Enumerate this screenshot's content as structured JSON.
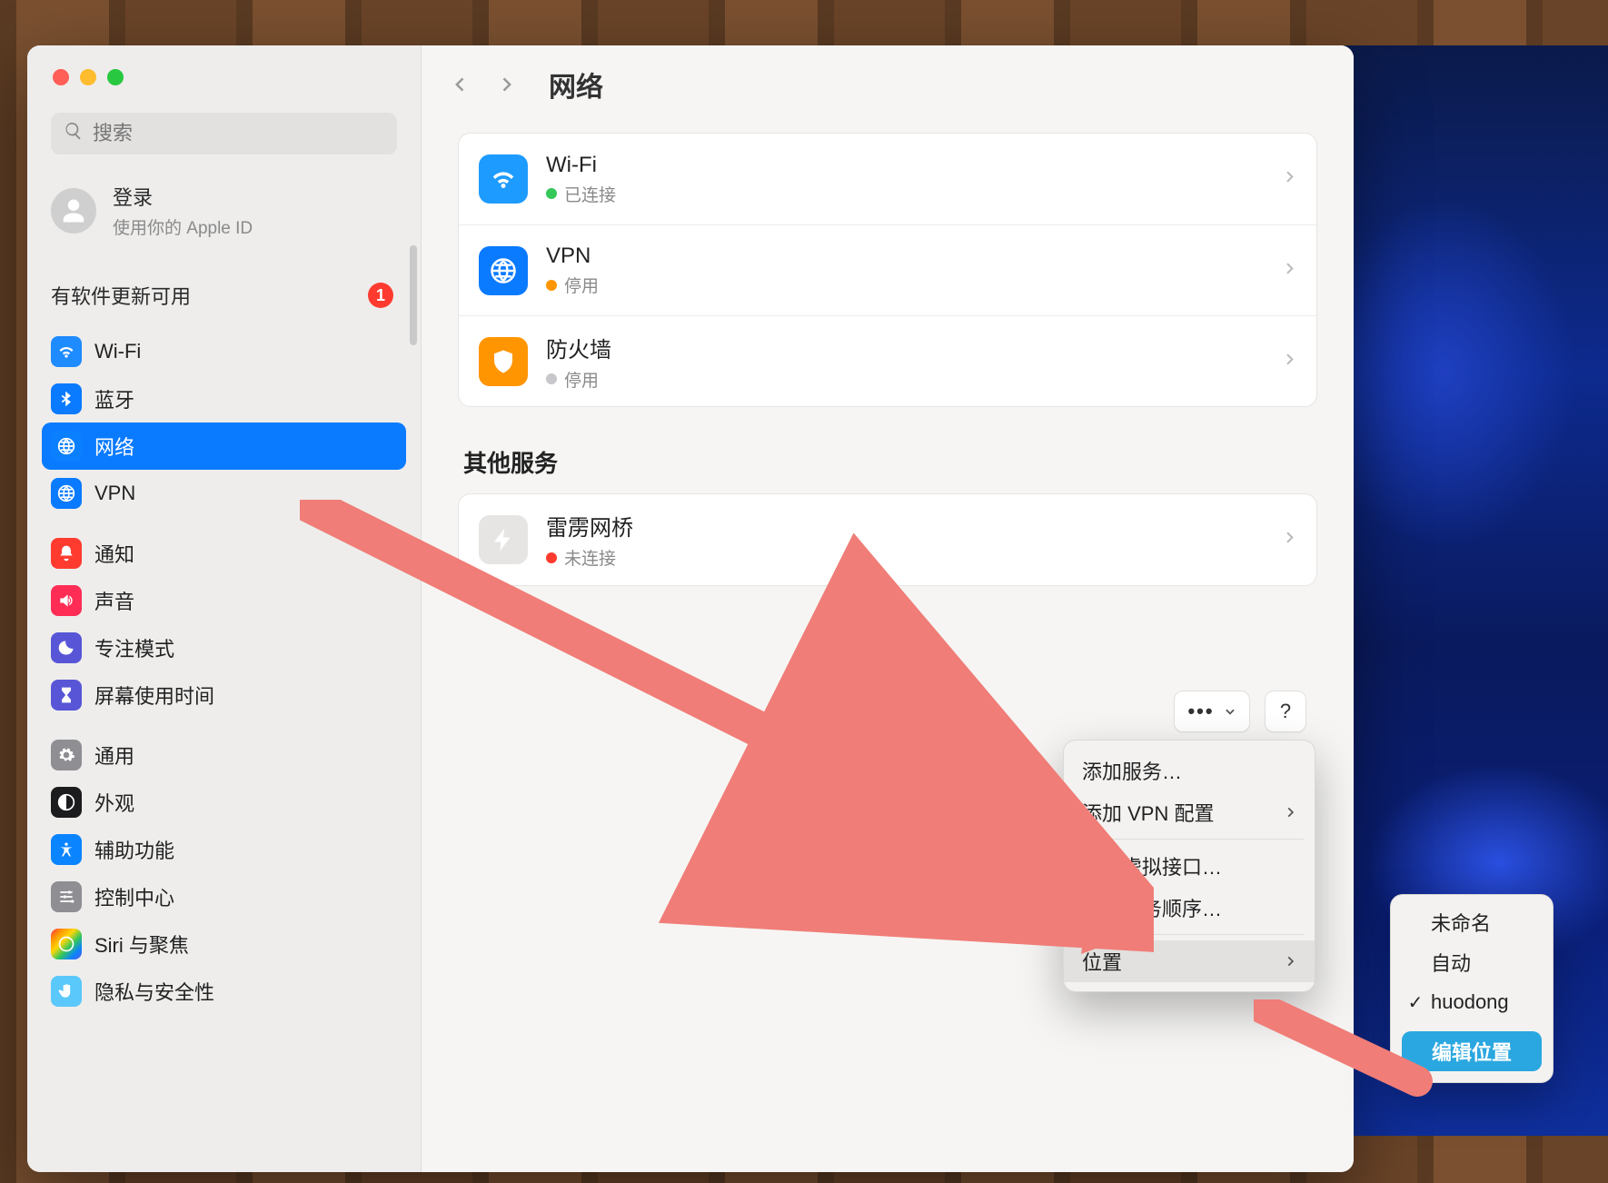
{
  "search": {
    "placeholder": "搜索"
  },
  "account": {
    "title": "登录",
    "subtitle": "使用你的 Apple ID"
  },
  "update": {
    "label": "有软件更新可用",
    "badge": "1"
  },
  "sidebar": {
    "items": [
      {
        "label": "Wi-Fi",
        "icon": "wifi-icon",
        "color": "ic-blue"
      },
      {
        "label": "蓝牙",
        "icon": "bluetooth-icon",
        "color": "ic-blue2"
      },
      {
        "label": "网络",
        "icon": "globe-icon",
        "color": "ic-blue2",
        "selected": true
      },
      {
        "label": "VPN",
        "icon": "globe-icon",
        "color": "ic-blue2"
      },
      {
        "label": "通知",
        "icon": "bell-icon",
        "color": "ic-red"
      },
      {
        "label": "声音",
        "icon": "speaker-icon",
        "color": "ic-pink"
      },
      {
        "label": "专注模式",
        "icon": "moon-icon",
        "color": "ic-indigo"
      },
      {
        "label": "屏幕使用时间",
        "icon": "hourglass-icon",
        "color": "ic-indigo"
      },
      {
        "label": "通用",
        "icon": "gear-icon",
        "color": "ic-gray"
      },
      {
        "label": "外观",
        "icon": "contrast-icon",
        "color": "ic-black"
      },
      {
        "label": "辅助功能",
        "icon": "accessibility-icon",
        "color": "ic-teal"
      },
      {
        "label": "控制中心",
        "icon": "sliders-icon",
        "color": "ic-gray"
      },
      {
        "label": "Siri 与聚焦",
        "icon": "siri-icon",
        "color": "ic-grad"
      },
      {
        "label": "隐私与安全性",
        "icon": "hand-icon",
        "color": "ic-sky"
      }
    ]
  },
  "header": {
    "title": "网络"
  },
  "services": {
    "primary": [
      {
        "title": "Wi-Fi",
        "status": "已连接",
        "dot": "d-green",
        "icon": "wifi-icon",
        "bg": "ric-blue"
      },
      {
        "title": "VPN",
        "status": "停用",
        "dot": "d-orange",
        "icon": "globe-icon",
        "bg": "ric-blue2"
      },
      {
        "title": "防火墙",
        "status": "停用",
        "dot": "d-gray",
        "icon": "shield-icon",
        "bg": "ric-orange"
      }
    ],
    "other_title": "其他服务",
    "other": [
      {
        "title": "雷雳网桥",
        "status": "未连接",
        "dot": "d-red",
        "icon": "bolt-icon",
        "bg": "ric-gray"
      }
    ]
  },
  "controls": {
    "help": "?"
  },
  "menu": {
    "add_service": "添加服务…",
    "add_vpn": "添加 VPN 配置",
    "manage_virt": "管理虚拟接口…",
    "set_order": "设定服务顺序…",
    "location": "位置"
  },
  "submenu": {
    "items": [
      {
        "label": "未命名",
        "checked": false
      },
      {
        "label": "自动",
        "checked": false
      },
      {
        "label": "huodong",
        "checked": true
      }
    ],
    "edit": "编辑位置"
  }
}
